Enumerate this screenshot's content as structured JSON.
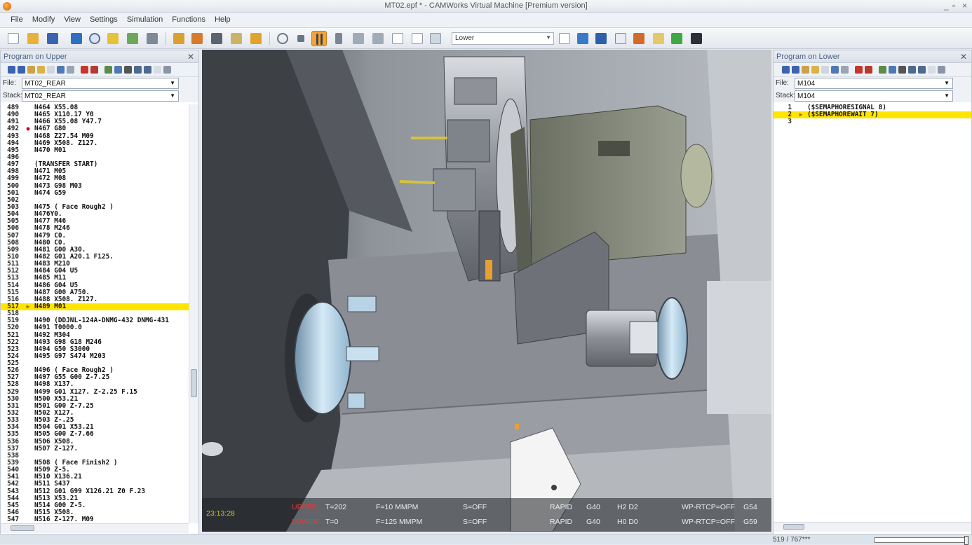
{
  "window": {
    "title": "MT02.epf * - CAMWorks Virtual Machine [Premium version]",
    "controls": [
      "_",
      "▫",
      "×"
    ]
  },
  "menu": [
    "File",
    "Modify",
    "View",
    "Settings",
    "Simulation",
    "Functions",
    "Help"
  ],
  "toolbar": {
    "channel_select": "Lower"
  },
  "left_panel": {
    "title": "Program on Upper",
    "file_label": "File:",
    "file_value": "MT02_REAR",
    "stack_label": "Stack:",
    "stack_value": "MT02_REAR",
    "current_line": "517",
    "breakpoint_line": "492",
    "lines": [
      {
        "n": "489",
        "t": "N464 X55.08"
      },
      {
        "n": "490",
        "t": "N465 X110.17 Y0"
      },
      {
        "n": "491",
        "t": "N466 X55.08 Y47.7"
      },
      {
        "n": "492",
        "t": "N467 G80"
      },
      {
        "n": "493",
        "t": "N468 Z27.54 M09"
      },
      {
        "n": "494",
        "t": "N469 X508. Z127."
      },
      {
        "n": "495",
        "t": "N470 M01"
      },
      {
        "n": "496",
        "t": ""
      },
      {
        "n": "497",
        "t": "(TRANSFER START)"
      },
      {
        "n": "498",
        "t": "N471 M05"
      },
      {
        "n": "499",
        "t": "N472 M08"
      },
      {
        "n": "500",
        "t": "N473 G98 M03"
      },
      {
        "n": "501",
        "t": "N474 G59"
      },
      {
        "n": "502",
        "t": ""
      },
      {
        "n": "503",
        "t": "N475 ( Face Rough2 )"
      },
      {
        "n": "504",
        "t": "N476Y0."
      },
      {
        "n": "505",
        "t": "N477 M46"
      },
      {
        "n": "506",
        "t": "N478 M246"
      },
      {
        "n": "507",
        "t": "N479 C0."
      },
      {
        "n": "508",
        "t": "N480 C0."
      },
      {
        "n": "509",
        "t": "N481 G00 A30."
      },
      {
        "n": "510",
        "t": "N482 G01 A20.1 F125."
      },
      {
        "n": "511",
        "t": "N483 M210"
      },
      {
        "n": "512",
        "t": "N484 G04 U5"
      },
      {
        "n": "513",
        "t": "N485 M11"
      },
      {
        "n": "514",
        "t": "N486 G04 U5"
      },
      {
        "n": "515",
        "t": "N487 G00 A750."
      },
      {
        "n": "516",
        "t": "N488 X508. Z127."
      },
      {
        "n": "517",
        "t": "N489 M01"
      },
      {
        "n": "518",
        "t": ""
      },
      {
        "n": "519",
        "t": "N490 (DDJNL-124A-DNMG-432 DNMG-431"
      },
      {
        "n": "520",
        "t": "N491 T0000.0"
      },
      {
        "n": "521",
        "t": "N492 M304"
      },
      {
        "n": "522",
        "t": "N493 G98 G18 M246"
      },
      {
        "n": "523",
        "t": "N494 G50 S3000"
      },
      {
        "n": "524",
        "t": "N495 G97 S474 M203"
      },
      {
        "n": "525",
        "t": ""
      },
      {
        "n": "526",
        "t": "N496 ( Face Rough2 )"
      },
      {
        "n": "527",
        "t": "N497 G55 G00 Z-7.25"
      },
      {
        "n": "528",
        "t": "N498 X137."
      },
      {
        "n": "529",
        "t": "N499 G01 X127. Z-2.25 F.15"
      },
      {
        "n": "530",
        "t": "N500 X53.21"
      },
      {
        "n": "531",
        "t": "N501 G00 Z-7.25"
      },
      {
        "n": "532",
        "t": "N502 X127."
      },
      {
        "n": "533",
        "t": "N503 Z-.25"
      },
      {
        "n": "534",
        "t": "N504 G01 X53.21"
      },
      {
        "n": "535",
        "t": "N505 G00 Z-7.66"
      },
      {
        "n": "536",
        "t": "N506 X508."
      },
      {
        "n": "537",
        "t": "N507 Z-127."
      },
      {
        "n": "538",
        "t": ""
      },
      {
        "n": "539",
        "t": "N508 ( Face Finish2 )"
      },
      {
        "n": "540",
        "t": "N509 Z-5."
      },
      {
        "n": "541",
        "t": "N510 X136.21"
      },
      {
        "n": "542",
        "t": "N511 S437"
      },
      {
        "n": "543",
        "t": "N512 G01 G99 X126.21 Z0 F.23"
      },
      {
        "n": "544",
        "t": "N513 X53.21"
      },
      {
        "n": "545",
        "t": "N514 G00 Z-5."
      },
      {
        "n": "546",
        "t": "N515 X508."
      },
      {
        "n": "547",
        "t": "N516 Z-127. M09"
      }
    ]
  },
  "right_panel": {
    "title": "Program on Lower",
    "file_label": "File:",
    "file_value": "M104",
    "stack_label": "Stack:",
    "stack_value": "M104",
    "current_line": "2",
    "lines": [
      {
        "n": "1",
        "t": "($SEMAPHORESIGNAL 8)"
      },
      {
        "n": "2",
        "t": "($SEMAPHOREWAIT 7)"
      },
      {
        "n": "3",
        "t": ""
      }
    ]
  },
  "hud": {
    "time": "23:13:28",
    "row1": {
      "ch": "UPPER",
      "tool": "T=202",
      "feed": "F=10 MMPM",
      "spindle": "S=OFF",
      "mode": "RAPID",
      "comp": "G40",
      "offsets": "H2 D2",
      "wp": "WP-RTCP=OFF",
      "wcs": "G54"
    },
    "row2": {
      "ch": "LOWER",
      "tool": "T=0",
      "feed": "F=125 MMPM",
      "spindle": "S=OFF",
      "mode": "RAPID",
      "comp": "G40",
      "offsets": "H0 D0",
      "wp": "WP-RTCP=OFF",
      "wcs": "G59"
    }
  },
  "status": {
    "position": "519 / 767***"
  }
}
